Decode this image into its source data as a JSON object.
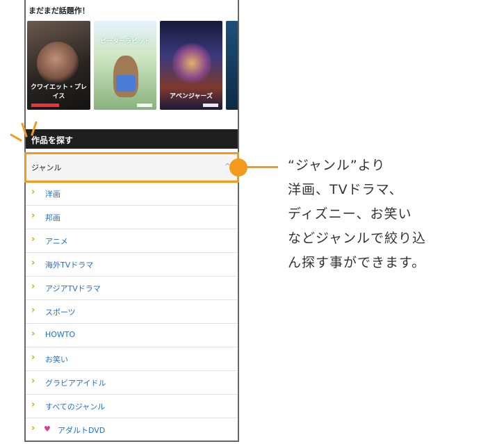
{
  "recommend": {
    "title": "まだまだ話題作！",
    "posters": [
      {
        "title": "クワイエット・プレイス"
      },
      {
        "title": "ピーターラビット"
      },
      {
        "title": "アベンジャーズ"
      }
    ]
  },
  "search": {
    "header": "作品を探す",
    "genre_label": "ジャンル",
    "genre_caret": "^"
  },
  "genres": [
    {
      "label": "洋画"
    },
    {
      "label": "邦画"
    },
    {
      "label": "アニメ"
    },
    {
      "label": "海外TVドラマ"
    },
    {
      "label": "アジアTVドラマ"
    },
    {
      "label": "スポーツ"
    },
    {
      "label": "HOWTO"
    },
    {
      "label": "お笑い"
    },
    {
      "label": "グラビアアイドル"
    },
    {
      "label": "すべてのジャンル"
    },
    {
      "label": "アダルトDVD",
      "icon": "heart-icon"
    }
  ],
  "annotation": {
    "lines": [
      "“ジャンル”より",
      "洋画、TVドラマ、",
      "ディズニー、お笑い",
      "などジャンルで絞り込",
      "ん探す事ができます。"
    ]
  },
  "colors": {
    "accent": "#f29b1c",
    "link": "#1e6fd9",
    "header_bg": "#1f1f1f",
    "heart": "#e83b8a"
  }
}
